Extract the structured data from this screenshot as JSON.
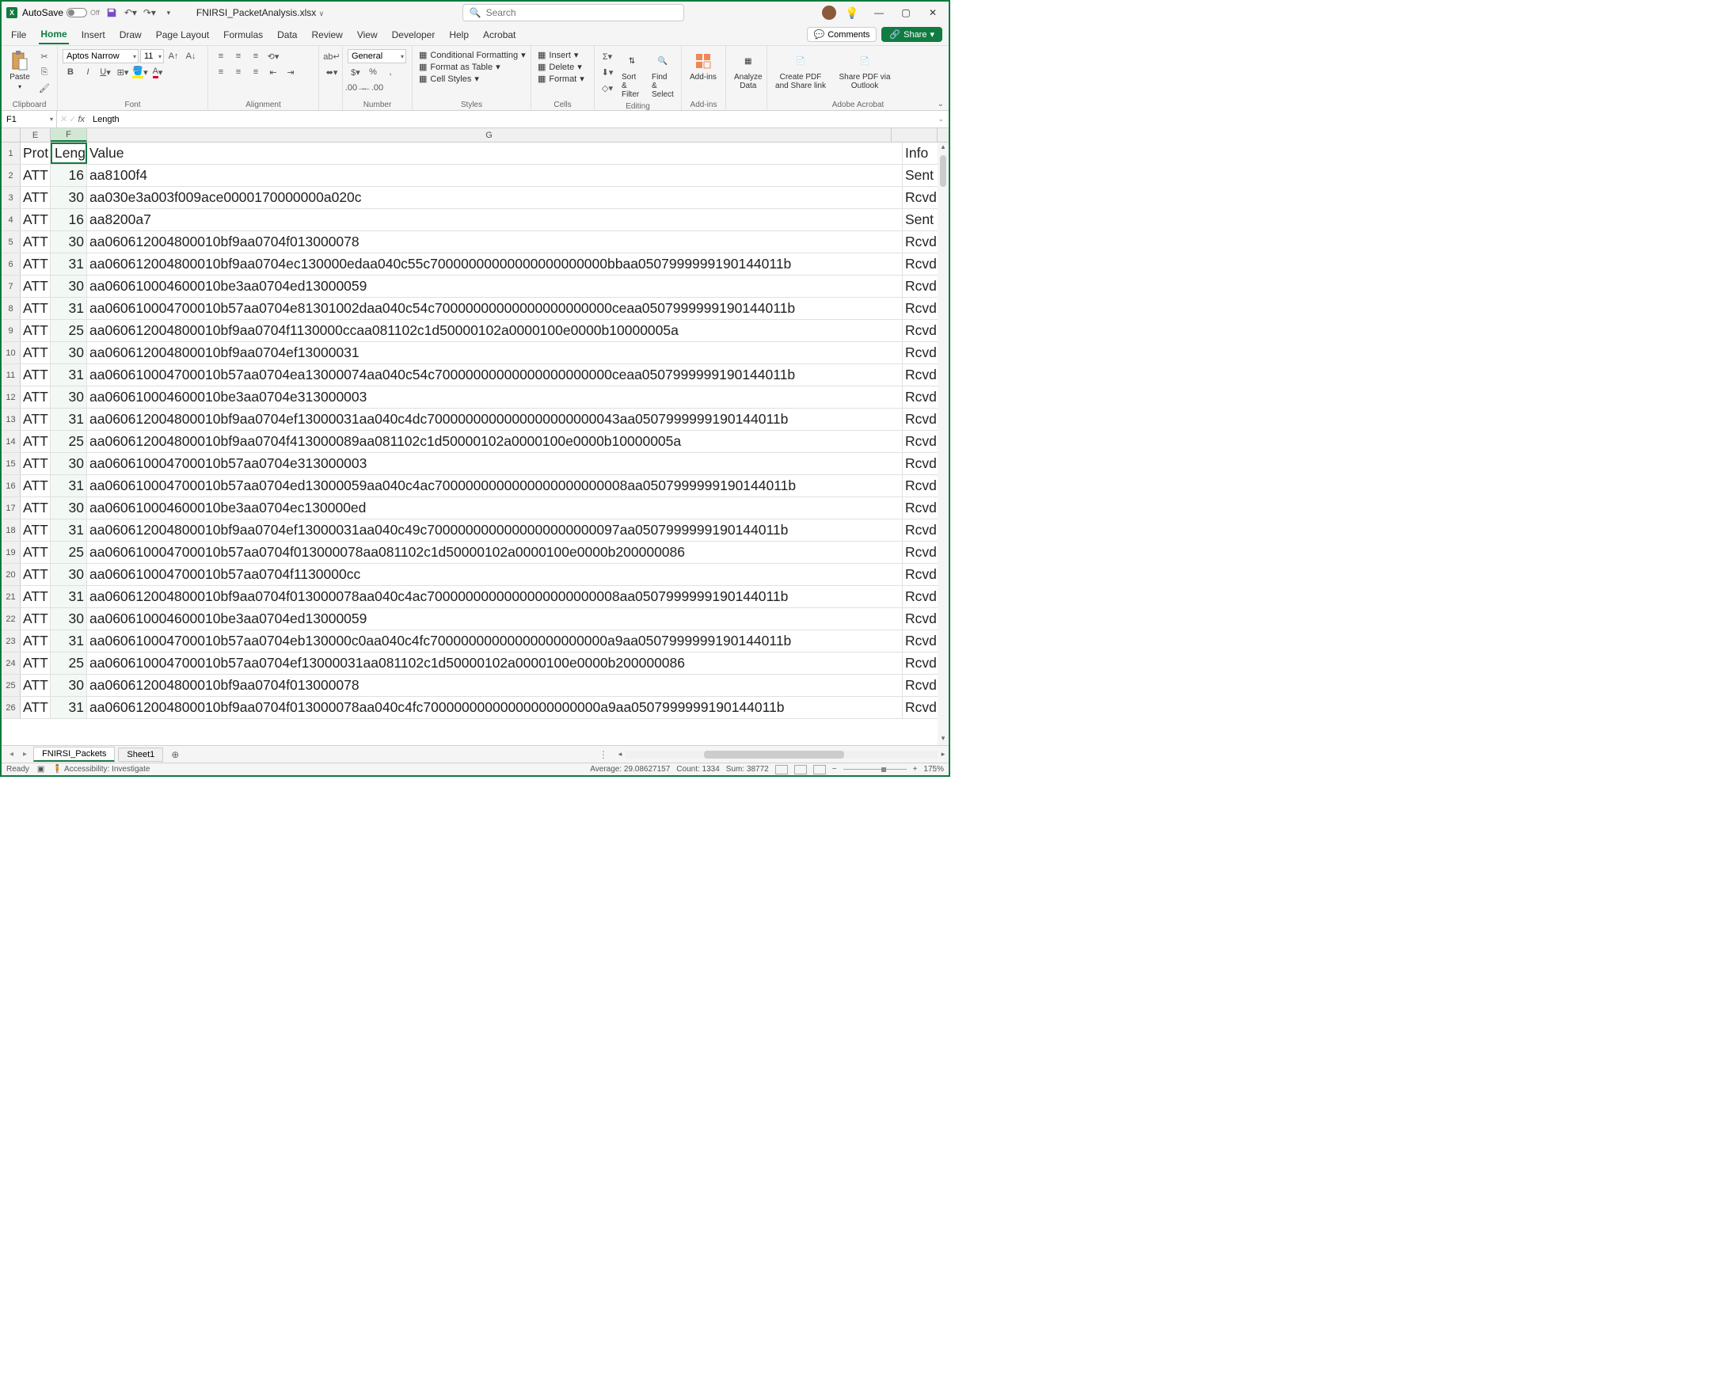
{
  "titlebar": {
    "autosave_label": "AutoSave",
    "autosave_state": "Off",
    "filename": "FNIRSI_PacketAnalysis.xlsx",
    "search_placeholder": "Search"
  },
  "tabs": {
    "items": [
      "File",
      "Home",
      "Insert",
      "Draw",
      "Page Layout",
      "Formulas",
      "Data",
      "Review",
      "View",
      "Developer",
      "Help",
      "Acrobat"
    ],
    "active": "Home",
    "comments": "Comments",
    "share": "Share"
  },
  "ribbon": {
    "clipboard": {
      "paste": "Paste",
      "label": "Clipboard"
    },
    "font": {
      "name": "Aptos Narrow",
      "size": "11",
      "label": "Font"
    },
    "alignment": {
      "label": "Alignment"
    },
    "number": {
      "format": "General",
      "label": "Number"
    },
    "styles": {
      "cond": "Conditional Formatting",
      "table": "Format as Table",
      "cell": "Cell Styles",
      "label": "Styles"
    },
    "cells": {
      "insert": "Insert",
      "delete": "Delete",
      "format": "Format",
      "label": "Cells"
    },
    "editing": {
      "sort": "Sort & Filter",
      "find": "Find & Select",
      "label": "Editing"
    },
    "addins": {
      "addins": "Add-ins",
      "label": "Add-ins"
    },
    "analyze": {
      "label": "Analyze Data"
    },
    "acrobat": {
      "pdf": "Create PDF and Share link",
      "outlook": "Share PDF via Outlook",
      "label": "Adobe Acrobat"
    }
  },
  "formula_bar": {
    "cell": "F1",
    "value": "Length"
  },
  "columns": {
    "E": "E",
    "F": "F",
    "G": "G",
    "H": ""
  },
  "headers": {
    "E": "Prot",
    "F": "Leng",
    "G": "Value",
    "H": "Info"
  },
  "rows": [
    {
      "n": 2,
      "e": "ATT",
      "f": "16",
      "g": "aa8100f4",
      "h": "Sent Wr"
    },
    {
      "n": 3,
      "e": "ATT",
      "f": "30",
      "g": "aa030e3a003f009ace0000170000000a020c",
      "h": "Rcvd Ha"
    },
    {
      "n": 4,
      "e": "ATT",
      "f": "16",
      "g": "aa8200a7",
      "h": "Sent Wr"
    },
    {
      "n": 5,
      "e": "ATT",
      "f": "30",
      "g": "aa060612004800010bf9aa0704f013000078",
      "h": "Rcvd Ha"
    },
    {
      "n": 6,
      "e": "ATT",
      "f": "31",
      "g": "aa060612004800010bf9aa0704ec130000edaa040c55c70000000000000000000000bbaa0507999999190144011b",
      "h": "Rcvd Ha"
    },
    {
      "n": 7,
      "e": "ATT",
      "f": "30",
      "g": "aa060610004600010be3aa0704ed13000059",
      "h": "Rcvd Ha"
    },
    {
      "n": 8,
      "e": "ATT",
      "f": "31",
      "g": "aa060610004700010b57aa0704e81301002daa040c54c70000000000000000000000ceaa0507999999190144011b",
      "h": "Rcvd Ha"
    },
    {
      "n": 9,
      "e": "ATT",
      "f": "25",
      "g": "aa060612004800010bf9aa0704f1130000ccaa081102c1d50000102a0000100e0000b10000005a",
      "h": "Rcvd Ha"
    },
    {
      "n": 10,
      "e": "ATT",
      "f": "30",
      "g": "aa060612004800010bf9aa0704ef13000031",
      "h": "Rcvd Ha"
    },
    {
      "n": 11,
      "e": "ATT",
      "f": "31",
      "g": "aa060610004700010b57aa0704ea13000074aa040c54c70000000000000000000000ceaa0507999999190144011b",
      "h": "Rcvd Ha"
    },
    {
      "n": 12,
      "e": "ATT",
      "f": "30",
      "g": "aa060610004600010be3aa0704e313000003",
      "h": "Rcvd Ha"
    },
    {
      "n": 13,
      "e": "ATT",
      "f": "31",
      "g": "aa060612004800010bf9aa0704ef13000031aa040c4dc7000000000000000000000043aa0507999999190144011b",
      "h": "Rcvd Ha"
    },
    {
      "n": 14,
      "e": "ATT",
      "f": "25",
      "g": "aa060612004800010bf9aa0704f413000089aa081102c1d50000102a0000100e0000b10000005a",
      "h": "Rcvd Ha"
    },
    {
      "n": 15,
      "e": "ATT",
      "f": "30",
      "g": "aa060610004700010b57aa0704e313000003",
      "h": "Rcvd Ha"
    },
    {
      "n": 16,
      "e": "ATT",
      "f": "31",
      "g": "aa060610004700010b57aa0704ed13000059aa040c4ac7000000000000000000000008aa0507999999190144011b",
      "h": "Rcvd Ha"
    },
    {
      "n": 17,
      "e": "ATT",
      "f": "30",
      "g": "aa060610004600010be3aa0704ec130000ed",
      "h": "Rcvd Ha"
    },
    {
      "n": 18,
      "e": "ATT",
      "f": "31",
      "g": "aa060612004800010bf9aa0704ef13000031aa040c49c7000000000000000000000097aa0507999999190144011b",
      "h": "Rcvd Ha"
    },
    {
      "n": 19,
      "e": "ATT",
      "f": "25",
      "g": "aa060610004700010b57aa0704f013000078aa081102c1d50000102a0000100e0000b200000086",
      "h": "Rcvd Ha"
    },
    {
      "n": 20,
      "e": "ATT",
      "f": "30",
      "g": "aa060610004700010b57aa0704f1130000cc",
      "h": "Rcvd Ha"
    },
    {
      "n": 21,
      "e": "ATT",
      "f": "31",
      "g": "aa060612004800010bf9aa0704f013000078aa040c4ac7000000000000000000000008aa0507999999190144011b",
      "h": "Rcvd Ha"
    },
    {
      "n": 22,
      "e": "ATT",
      "f": "30",
      "g": "aa060610004600010be3aa0704ed13000059",
      "h": "Rcvd Ha"
    },
    {
      "n": 23,
      "e": "ATT",
      "f": "31",
      "g": "aa060610004700010b57aa0704eb130000c0aa040c4fc70000000000000000000000a9aa0507999999190144011b",
      "h": "Rcvd Ha"
    },
    {
      "n": 24,
      "e": "ATT",
      "f": "25",
      "g": "aa060610004700010b57aa0704ef13000031aa081102c1d50000102a0000100e0000b200000086",
      "h": "Rcvd Ha"
    },
    {
      "n": 25,
      "e": "ATT",
      "f": "30",
      "g": "aa060612004800010bf9aa0704f013000078",
      "h": "Rcvd Ha"
    },
    {
      "n": 26,
      "e": "ATT",
      "f": "31",
      "g": "aa060612004800010bf9aa0704f013000078aa040c4fc70000000000000000000000a9aa0507999999190144011b",
      "h": "Rcvd Ha"
    }
  ],
  "sheet_tabs": {
    "active": "FNIRSI_Packets",
    "other": "Sheet1"
  },
  "statusbar": {
    "ready": "Ready",
    "accessibility": "Accessibility: Investigate",
    "average": "Average: 29.08627157",
    "count": "Count: 1334",
    "sum": "Sum: 38772",
    "zoom": "175%"
  }
}
